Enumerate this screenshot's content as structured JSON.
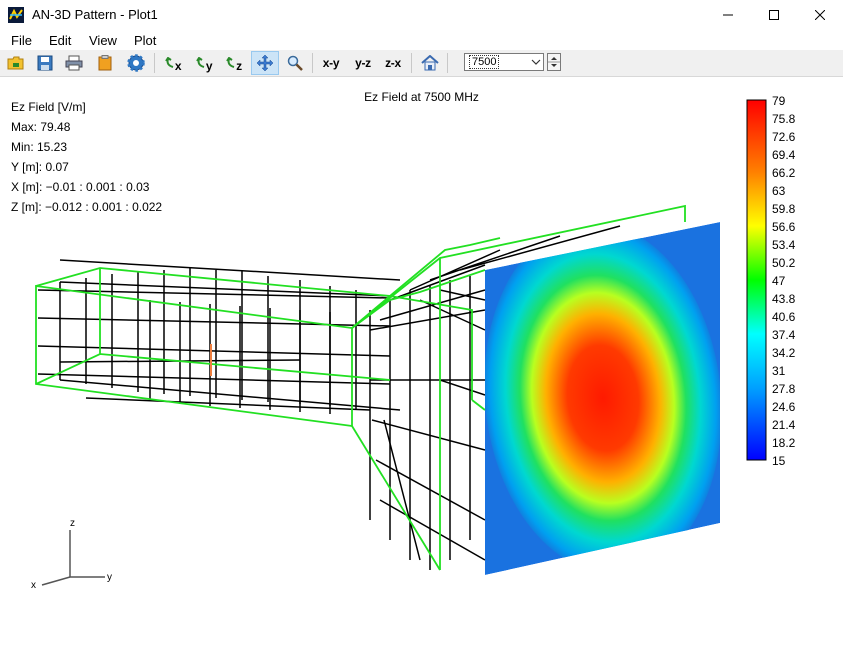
{
  "window": {
    "title": "AN-3D Pattern - Plot1"
  },
  "menu": [
    "File",
    "Edit",
    "View",
    "Plot"
  ],
  "toolbar": {
    "rotate_x": "x",
    "rotate_y": "y",
    "rotate_z": "z",
    "view_xy": "x-y",
    "view_yz": "y-z",
    "view_zx": "z-x",
    "frequency_value": "7500"
  },
  "plot": {
    "title": "Ez Field at 7500 MHz",
    "info": [
      "Ez Field [V/m]",
      "Max: 79.48",
      "Min: 15.23",
      "Y [m]: 0.07",
      "X [m]: −0.01 : 0.001 : 0.03",
      "Z [m]: −0.012 : 0.001 : 0.022"
    ],
    "colorbar_labels": [
      "79",
      "75.8",
      "72.6",
      "69.4",
      "66.2",
      "63",
      "59.8",
      "56.6",
      "53.4",
      "50.2",
      "47",
      "43.8",
      "40.6",
      "37.4",
      "34.2",
      "31",
      "27.8",
      "24.6",
      "21.4",
      "18.2",
      "15"
    ],
    "axes": {
      "z": "z",
      "y": "y",
      "x": "x"
    }
  }
}
